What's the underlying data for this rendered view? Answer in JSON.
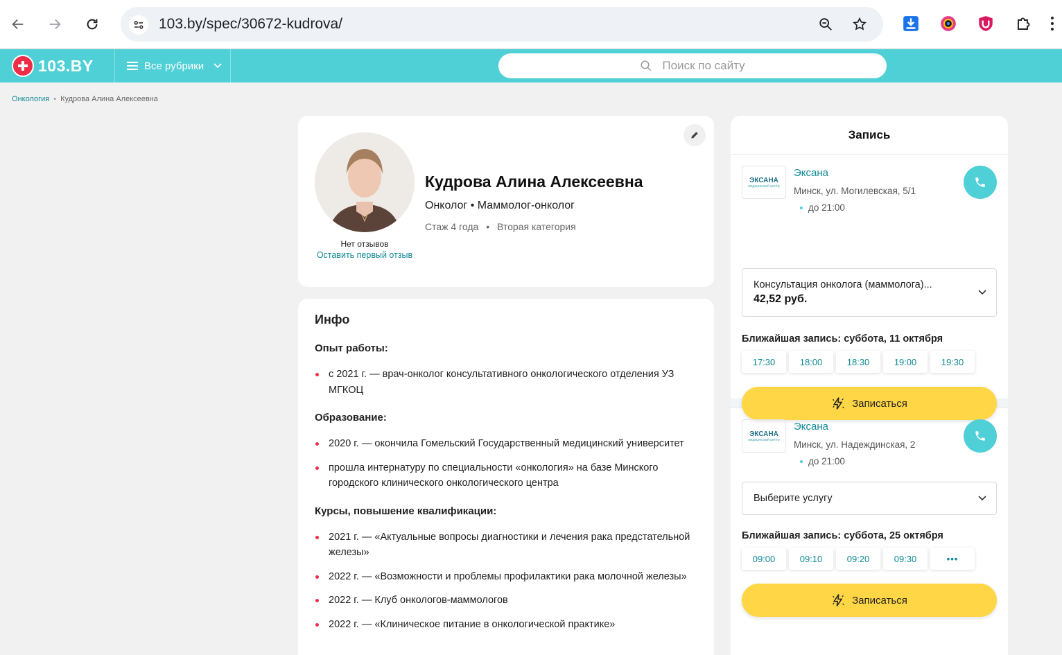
{
  "browser": {
    "url": "103.by/spec/30672-kudrova/"
  },
  "site": {
    "logo_text": "103.BY",
    "rubrics_label": "Все рубрики",
    "search_placeholder": "Поиск по сайту",
    "accent_color": "#4fcfd6",
    "brand_red": "#ee2e48",
    "button_yellow": "#ffd646"
  },
  "breadcrumb": {
    "items": [
      "Онкология",
      "Кудрова Алина Алексеевна"
    ]
  },
  "profile": {
    "name": "Кудрова Алина Алексеевна",
    "specialties": "Онколог • Маммолог-онколог",
    "experience": "Стаж 4 года",
    "category": "Вторая категория",
    "no_reviews": "Нет отзывов",
    "first_review_link": "Оставить первый отзыв"
  },
  "info": {
    "title": "Инфо",
    "sections": [
      {
        "heading": "Опыт работы:",
        "items": [
          "с 2021 г. — врач-онколог консультативного онкологического отделения УЗ МГКОЦ"
        ]
      },
      {
        "heading": "Образование:",
        "items": [
          "2020 г. — окончила Гомельский Государственный медицинский университет",
          "прошла интернатуру по специальности «онкология» на базе Минского городского клинического онкологического центра"
        ]
      },
      {
        "heading": "Курсы, повышение квалификации:",
        "items": [
          "2021 г. — «Актуальные вопросы диагностики и лечения рака предстательной железы»",
          "2022 г. — «Возможности и проблемы профилактики рака молочной железы»",
          "2022 г. — Клуб онкологов-маммологов",
          "2022 г. — «Клиническое питание в онкологической практике»"
        ]
      }
    ]
  },
  "booking": {
    "title": "Запись",
    "clinics": [
      {
        "logo_text": "ЭКСАНА",
        "logo_sub": "медицинский центр",
        "name": "Эксана",
        "address": "Минск, ул. Могилевская, 5/1",
        "hours": "до 21:00",
        "service_name": "Консультация онколога (маммолога)...",
        "service_price": "42,52 руб.",
        "nearest": "Ближайшая запись: суббота, 11 октября",
        "slots": [
          "17:30",
          "18:00",
          "18:30",
          "19:00",
          "19:30"
        ],
        "book_label": "Записаться"
      },
      {
        "logo_text": "ЭКСАНА",
        "logo_sub": "медицинский центр",
        "name": "Эксана",
        "address": "Минск, ул. Надеждинская, 2",
        "hours": "до 21:00",
        "service_placeholder": "Выберите услугу",
        "nearest": "Ближайшая запись: суббота, 25 октября",
        "slots": [
          "09:00",
          "09:10",
          "09:20",
          "09:30"
        ],
        "more_label": "•••",
        "book_label": "Записаться"
      }
    ]
  }
}
